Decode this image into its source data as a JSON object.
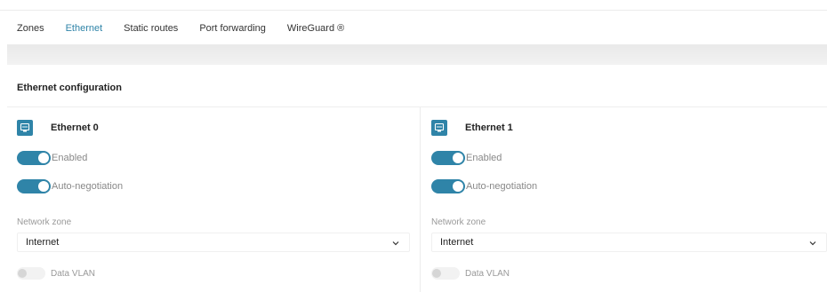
{
  "tabs": [
    {
      "label": "Zones",
      "active": false
    },
    {
      "label": "Ethernet",
      "active": true
    },
    {
      "label": "Static routes",
      "active": false
    },
    {
      "label": "Port forwarding",
      "active": false
    },
    {
      "label": "WireGuard ®",
      "active": false
    }
  ],
  "section": {
    "title": "Ethernet configuration"
  },
  "colors": {
    "accent": "#2f84a8"
  },
  "ports": [
    {
      "name": "Ethernet 0",
      "icon": "ethernet-port-icon",
      "enabled_label": "Enabled",
      "enabled": true,
      "autoneg_label": "Auto-negotiation",
      "autoneg": true,
      "network_zone_label": "Network zone",
      "network_zone_value": "Internet",
      "vlan_label": "Data VLAN",
      "vlan": false
    },
    {
      "name": "Ethernet 1",
      "icon": "ethernet-port-icon",
      "enabled_label": "Enabled",
      "enabled": true,
      "autoneg_label": "Auto-negotiation",
      "autoneg": true,
      "network_zone_label": "Network zone",
      "network_zone_value": "Internet",
      "vlan_label": "Data VLAN",
      "vlan": false
    }
  ]
}
